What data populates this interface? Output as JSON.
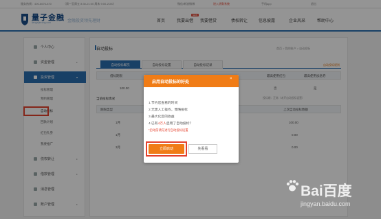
{
  "topbar": {
    "service": "服务热线：400-6676-870",
    "hours": "（周一至周五 8:30-21:00 周末 9:00-2100）",
    "weibo": "微信/新浪微博",
    "vip": "进入贷款系统",
    "app": "手机app",
    "login": "退出"
  },
  "header": {
    "logo": "量子金融",
    "logo_sub": "liangzijinrong.com",
    "slogan": "金融投资领先理财",
    "nav": [
      "首页",
      "我要出借",
      "我要借贷",
      "债权转让",
      "信息披露",
      "企业风采",
      "帮助中心"
    ],
    "hot_badge": "NEW"
  },
  "sidebar": {
    "items": [
      {
        "label": "个人中心"
      },
      {
        "label": "资金管理"
      },
      {
        "label": "投资管理"
      },
      {
        "label": "债权转让"
      },
      {
        "label": "借款管理"
      },
      {
        "label": "消息管理"
      },
      {
        "label": "账户管理"
      }
    ],
    "subitems": [
      "投标管理",
      "预约管理",
      "自动投标",
      "回款计划",
      "红包礼券",
      "我要推广"
    ]
  },
  "content": {
    "title": "自动投标",
    "breadcrumb": "首页 > 我的账户 > 自动投标",
    "tabs": [
      "自动投标概况",
      "自动投标设置",
      "自动投标记录"
    ],
    "rule_link": "自动投标规则",
    "table_head": [
      "借标期限",
      "",
      "",
      "",
      "最高使用红包",
      "最高使用加息券"
    ],
    "row1": [
      "100.00",
      "",
      "",
      "",
      "否",
      "是"
    ],
    "note": "当前投标情况",
    "note_right": "投标期：正常（未开自动投标设置）",
    "head2": [
      "期限类型",
      "",
      "",
      "",
      "上次自动投标数额"
    ],
    "rows": [
      [
        "1月",
        "",
        "",
        "",
        "100.00"
      ],
      [
        "1月",
        "",
        "",
        "",
        "0.00"
      ],
      [
        "3月",
        "",
        "",
        "",
        "0.00"
      ]
    ]
  },
  "modal": {
    "title": "启用自动投标的好处",
    "lines": [
      "1.节约您查看的时间",
      "2.无需人工操作，策略投标",
      "3.最大化您的收益",
      "4.已有"
    ],
    "highlight": "4万人",
    "line4_tail": "启用了自动投标？",
    "warn": "*启动前请先进行自动投标设置",
    "primary": "立即启动",
    "secondary": "先看看"
  },
  "watermark": {
    "brand": "Bai百度",
    "site": "jingyan.baidu.com"
  }
}
